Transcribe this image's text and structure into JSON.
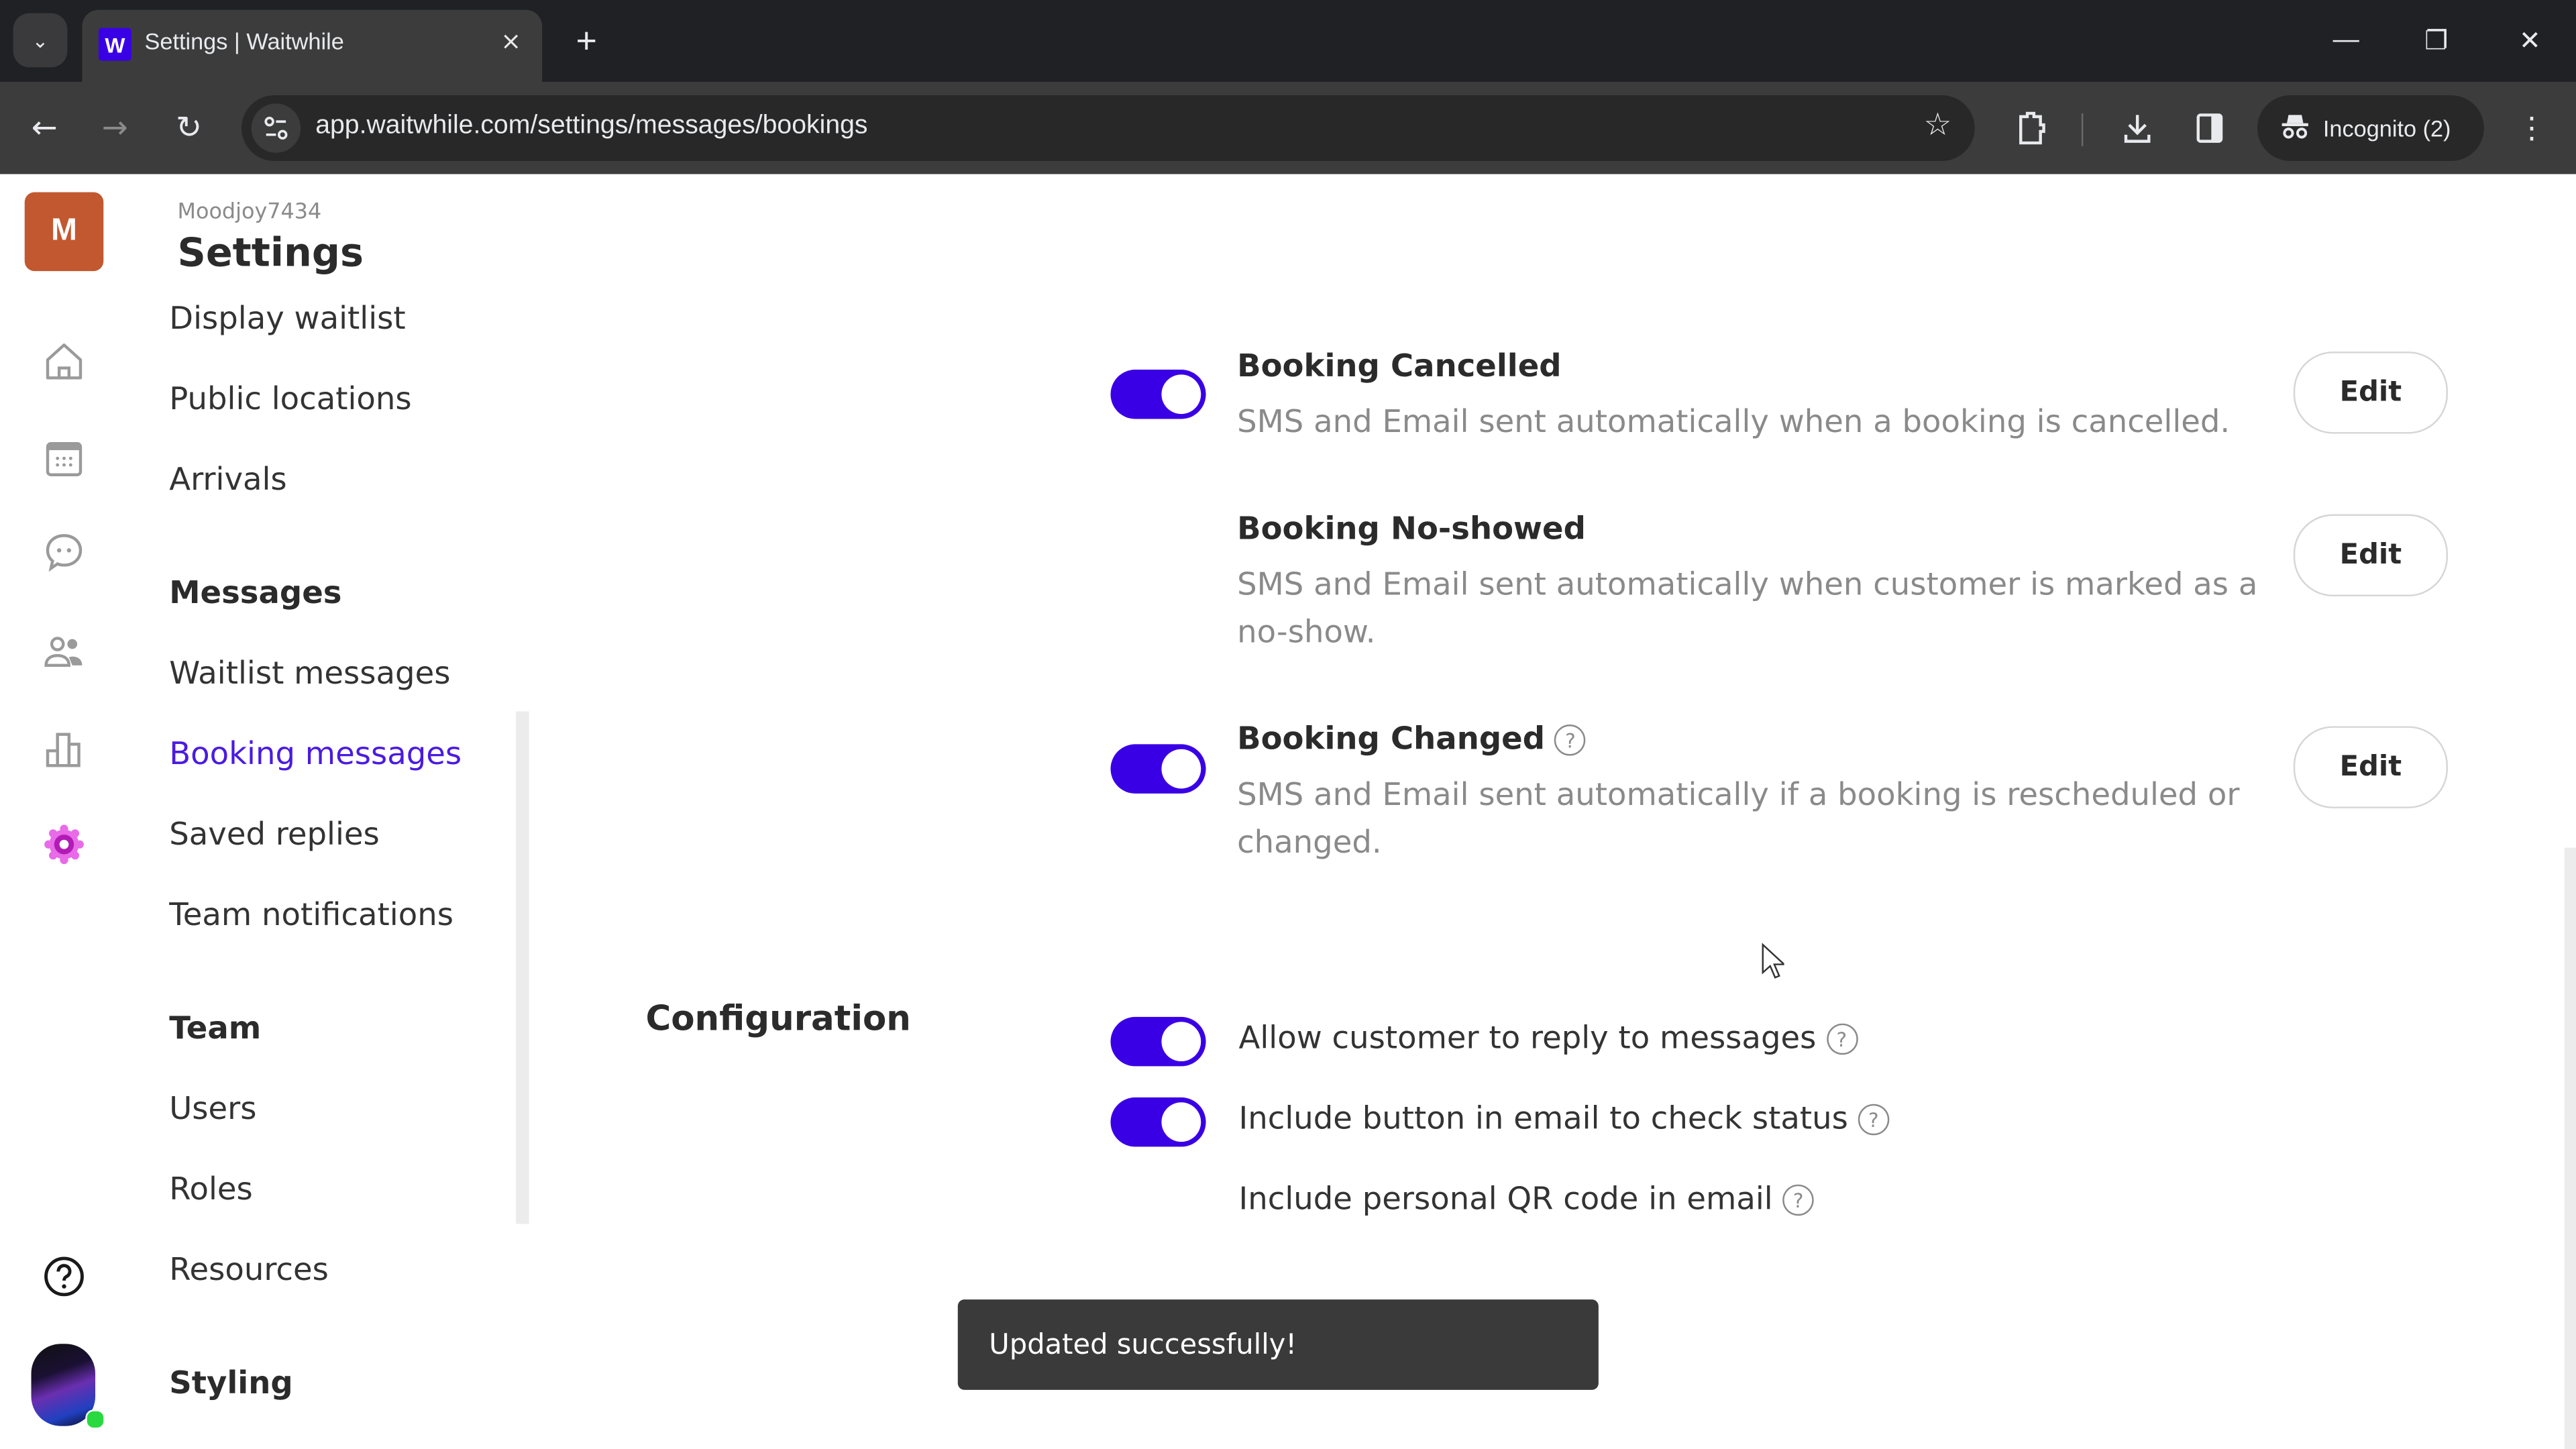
{
  "browser": {
    "tab": {
      "favicon": "W",
      "title": "Settings | Waitwhile",
      "close_icon": "×"
    },
    "new_tab_label": "+",
    "window_controls": {
      "minimize": "—",
      "restore": "❐",
      "close": "✕"
    },
    "nav": {
      "back": "←",
      "forward": "→",
      "reload": "↻"
    },
    "url": "app.waitwhile.com/settings/messages/bookings",
    "incognito_label": "Incognito (2)"
  },
  "rail": {
    "org_initial": "M",
    "icons": [
      "home-icon",
      "calendar-icon",
      "chat-icon",
      "users-icon",
      "analytics-icon",
      "settings-icon",
      "help-icon"
    ]
  },
  "settings_nav": {
    "org_name": "Moodjoy7434",
    "title": "Settings",
    "items": [
      {
        "label": "Display waitlist",
        "type": "item"
      },
      {
        "label": "Public locations",
        "type": "item"
      },
      {
        "label": "Arrivals",
        "type": "item"
      },
      {
        "label": "Messages",
        "type": "heading"
      },
      {
        "label": "Waitlist messages",
        "type": "item"
      },
      {
        "label": "Booking messages",
        "type": "item",
        "active": true
      },
      {
        "label": "Saved replies",
        "type": "item"
      },
      {
        "label": "Team notifications",
        "type": "item"
      },
      {
        "label": "Team",
        "type": "heading"
      },
      {
        "label": "Users",
        "type": "item"
      },
      {
        "label": "Roles",
        "type": "item"
      },
      {
        "label": "Resources",
        "type": "item"
      },
      {
        "label": "Styling",
        "type": "heading"
      }
    ]
  },
  "messages": [
    {
      "title": "Booking Cancelled",
      "description": "SMS and Email sent automatically when a booking is cancelled.",
      "enabled": true,
      "has_toggle": true,
      "has_help": false,
      "edit_label": "Edit"
    },
    {
      "title": "Booking No-showed",
      "description": "SMS and Email sent automatically when customer is marked as a no-show.",
      "enabled": false,
      "has_toggle": false,
      "has_help": false,
      "edit_label": "Edit"
    },
    {
      "title": "Booking Changed",
      "description": "SMS and Email sent automatically if a booking is rescheduled or changed.",
      "enabled": true,
      "has_toggle": true,
      "has_help": true,
      "edit_label": "Edit"
    }
  ],
  "configuration": {
    "label": "Configuration",
    "items": [
      {
        "label": "Allow customer to reply to messages",
        "enabled": true,
        "has_toggle": true
      },
      {
        "label": "Include button in email to check status",
        "enabled": true,
        "has_toggle": true
      },
      {
        "label": "Include personal QR code in email",
        "enabled": false,
        "has_toggle": false
      }
    ]
  },
  "help_glyph": "?",
  "toast": {
    "message": "Updated successfully!"
  },
  "colors": {
    "accent": "#3a00e5",
    "active_nav": "#4a1be0",
    "org_avatar": "#c2582f",
    "toast_bg": "#3a3a3a",
    "online": "#28d93f"
  }
}
